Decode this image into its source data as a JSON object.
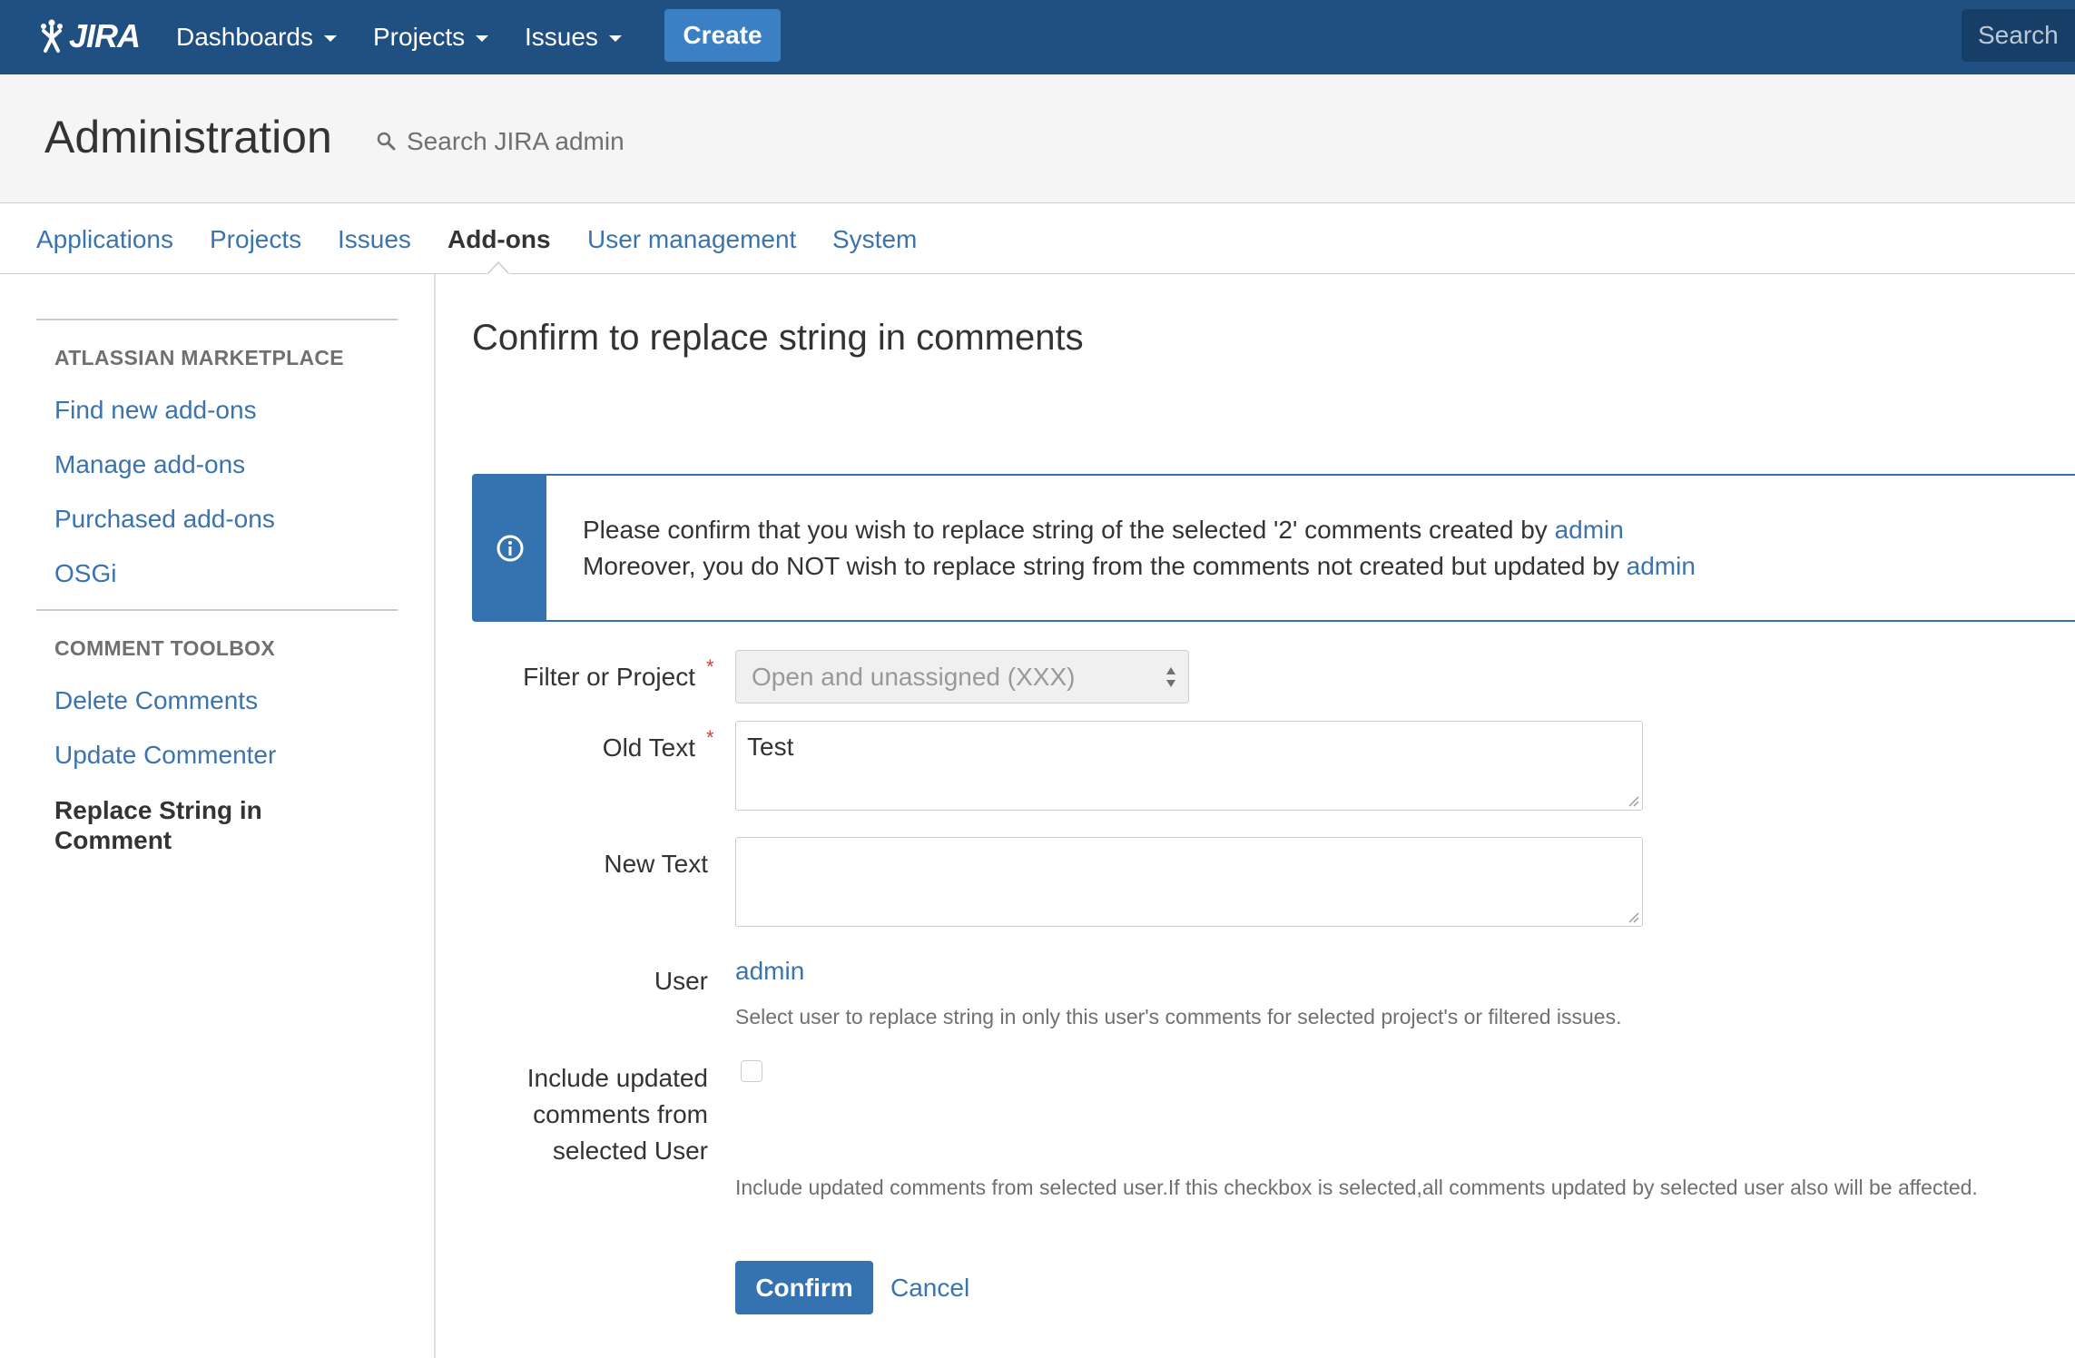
{
  "topbar": {
    "logo_text": "JIRA",
    "nav": [
      {
        "label": "Dashboards"
      },
      {
        "label": "Projects"
      },
      {
        "label": "Issues"
      }
    ],
    "create_label": "Create",
    "search_placeholder": "Search"
  },
  "admin": {
    "title": "Administration",
    "search_placeholder": "Search JIRA admin"
  },
  "tabs": [
    {
      "label": "Applications",
      "active": false
    },
    {
      "label": "Projects",
      "active": false
    },
    {
      "label": "Issues",
      "active": false
    },
    {
      "label": "Add-ons",
      "active": true
    },
    {
      "label": "User management",
      "active": false
    },
    {
      "label": "System",
      "active": false
    }
  ],
  "sidebar": {
    "sections": [
      {
        "heading": "ATLASSIAN MARKETPLACE",
        "items": [
          {
            "label": "Find new add-ons"
          },
          {
            "label": "Manage add-ons"
          },
          {
            "label": "Purchased add-ons"
          },
          {
            "label": "OSGi"
          }
        ]
      },
      {
        "heading": "COMMENT TOOLBOX",
        "items": [
          {
            "label": "Delete Comments"
          },
          {
            "label": "Update Commenter"
          },
          {
            "label": "Replace String in Comment",
            "active": true
          }
        ]
      }
    ]
  },
  "main": {
    "title": "Confirm to replace string in comments",
    "info": {
      "line1_text": "Please confirm that you wish to replace string of the selected '2' comments created by ",
      "line1_link": "admin",
      "line2_text": "Moreover, you do NOT wish to replace string from the comments not created but updated by ",
      "line2_link": "admin"
    },
    "form": {
      "filter_label": "Filter or Project",
      "filter_value": "Open and unassigned (XXX)",
      "old_text_label": "Old Text",
      "old_text_value": "Test",
      "new_text_label": "New Text",
      "new_text_value": "",
      "required_mark": "*",
      "user_label": "User",
      "user_value": "admin",
      "user_help": "Select user to replace string in only this user's comments for selected project's or filtered issues.",
      "include_label": "Include updated comments from selected User",
      "include_checked": false,
      "include_help": "Include updated comments from selected user.If this checkbox is selected,all comments updated by selected user also will be affected.",
      "confirm_label": "Confirm",
      "cancel_label": "Cancel"
    }
  },
  "colors": {
    "header_bg": "#205081",
    "primary": "#3572b0",
    "link": "#3b73af",
    "required": "#d04437"
  }
}
